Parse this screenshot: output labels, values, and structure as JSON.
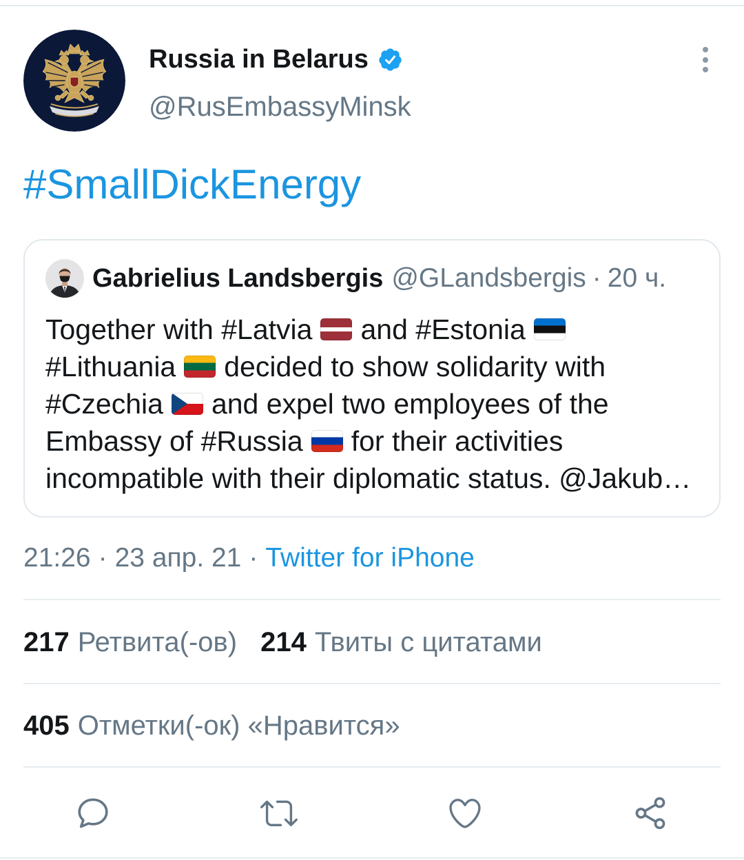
{
  "colors": {
    "primary_text": "#14171a",
    "secondary_text": "#657786",
    "link": "#1b95e0",
    "verified": "#1da1f2",
    "border": "#e1e8ed",
    "avatar_background": "#0b1838",
    "emblem_gold": "#c9a45a"
  },
  "tweet": {
    "author": {
      "avatar_icon": "double-headed-eagle-emblem-icon",
      "name": "Russia in Belarus",
      "verified_icon": "verified-badge-icon",
      "handle": "@RusEmbassyMinsk",
      "more_icon": "more-vertical-icon"
    },
    "text": "#SmallDickEnergy",
    "quoted": {
      "avatar_icon": "user-photo-icon",
      "author_name": "Gabrielius Landsbergis",
      "handle": "@GLandsbergis",
      "separator": "·",
      "time": "20 ч.",
      "lines": [
        {
          "parts": [
            "Together with #Latvia",
            "and #Estonia"
          ],
          "flags": [
            "flag-latvia-icon",
            "flag-estonia-icon"
          ]
        },
        {
          "parts": [
            "#Lithuania",
            "decided to show solidarity with"
          ],
          "flags": [
            "flag-lithuania-icon"
          ]
        },
        {
          "parts": [
            "#Czechia",
            "and expel two employees of the"
          ],
          "flags": [
            "flag-czechia-icon"
          ]
        },
        {
          "parts": [
            "Embassy of #Russia",
            "for their activities"
          ],
          "flags": [
            "flag-russia-icon"
          ]
        },
        {
          "parts": [
            "incompatible with their diplomatic status. @Jakub…"
          ],
          "flags": []
        }
      ]
    },
    "meta": {
      "time": "21:26",
      "separator": "·",
      "date": "23 апр. 21",
      "source": "Twitter for iPhone"
    },
    "stats": {
      "retweets": {
        "count": "217",
        "label": "Ретвита(-ов)"
      },
      "quote_tweets": {
        "count": "214",
        "label": "Твиты с цитатами"
      },
      "likes": {
        "count": "405",
        "label": "Отметки(-ок) «Нравится»"
      }
    },
    "actions": [
      "reply-icon",
      "retweet-icon",
      "heart-icon",
      "share-icon"
    ]
  }
}
